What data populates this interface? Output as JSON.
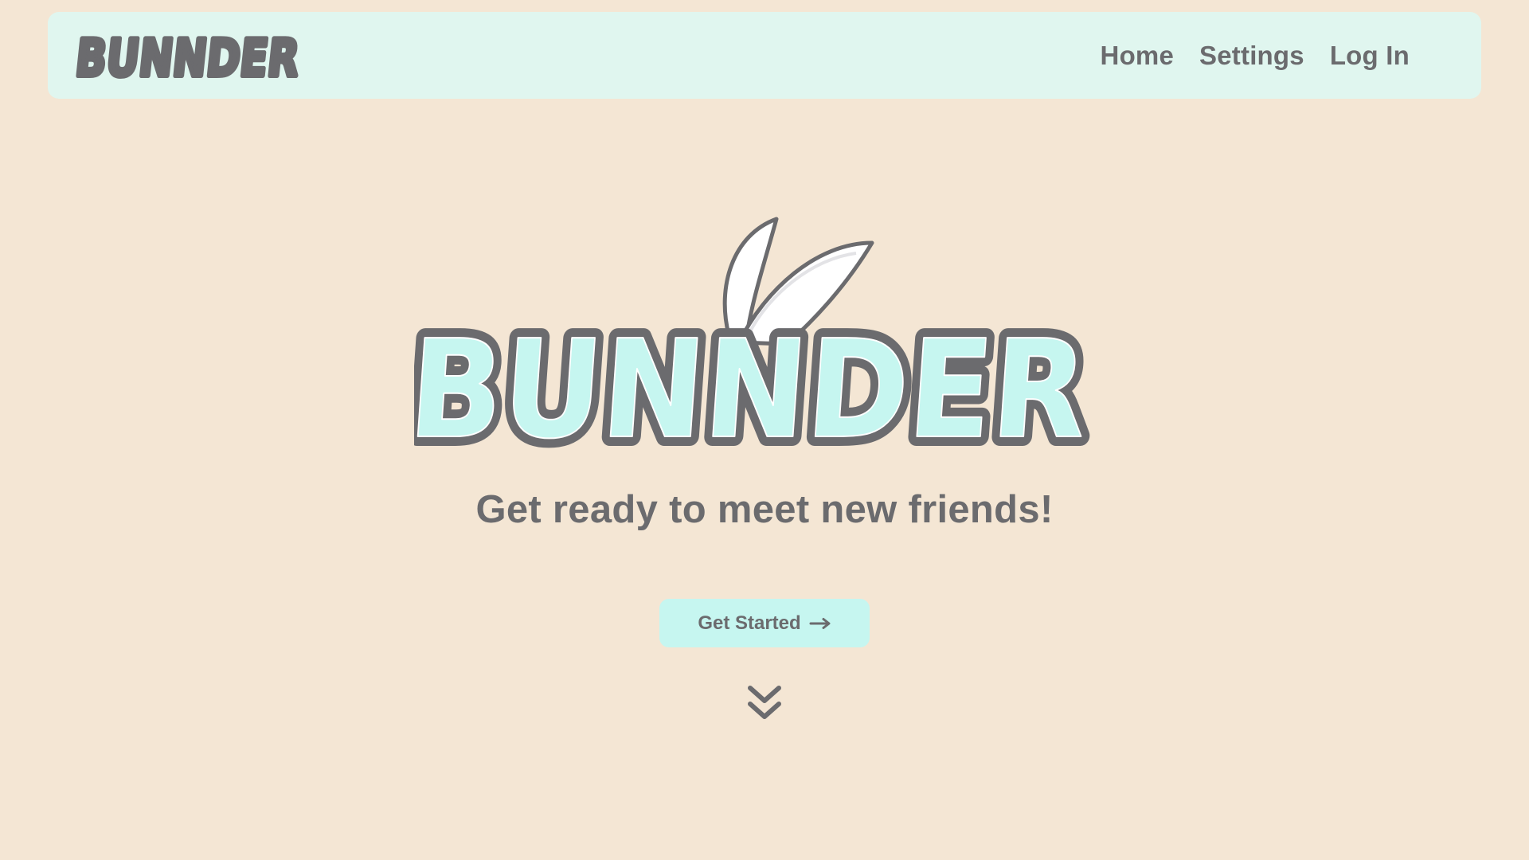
{
  "brand": {
    "name": "BUNNDER",
    "text_color": "#6b6b6e",
    "accent_color": "#c6f6f0"
  },
  "nav": {
    "items": [
      {
        "label": "Home"
      },
      {
        "label": "Settings"
      },
      {
        "label": "Log In"
      }
    ]
  },
  "hero": {
    "logo_text": "BUNNDER",
    "tagline": "Get ready to meet new friends!",
    "cta_label": "Get Started",
    "cta_icon": "arrow-right-icon",
    "scroll_icon": "double-chevron-down-icon"
  },
  "colors": {
    "background": "#f4e6d4",
    "navbar": "#e0f6ef",
    "button": "#c6f6f0",
    "text": "#6b6b6e"
  }
}
